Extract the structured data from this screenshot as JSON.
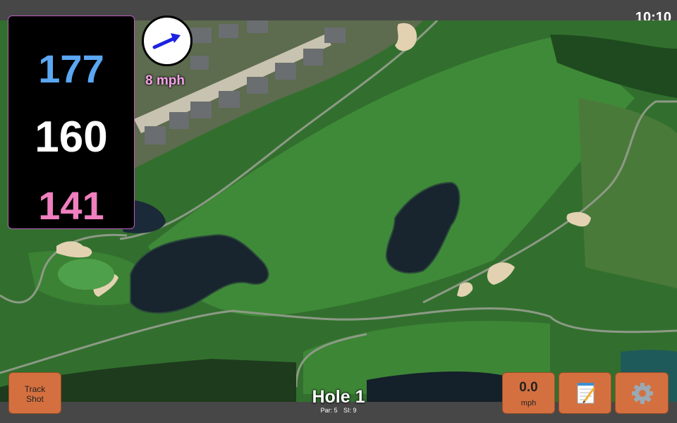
{
  "status_bar": {
    "time": "10:10"
  },
  "distances": {
    "back": "177",
    "middle": "160",
    "front": "141",
    "back_color": "#5ba7f2",
    "middle_color": "#ffffff",
    "front_color": "#f07fbf"
  },
  "wind": {
    "speed": "8 mph",
    "direction_icon": "arrow-right-icon"
  },
  "hole": {
    "title": "Hole 1",
    "par": "Par: 5",
    "si": "SI: 9"
  },
  "buttons": {
    "track_shot_line1": "Track",
    "track_shot_line2": "Shot",
    "speed_value": "0.0",
    "speed_unit": "mph",
    "notes_icon": "notepad-icon",
    "settings_icon": "gear-icon"
  },
  "colors": {
    "button_bg": "#d4703f",
    "bar_bg": "#474747",
    "panel_border": "#c05bc0"
  }
}
